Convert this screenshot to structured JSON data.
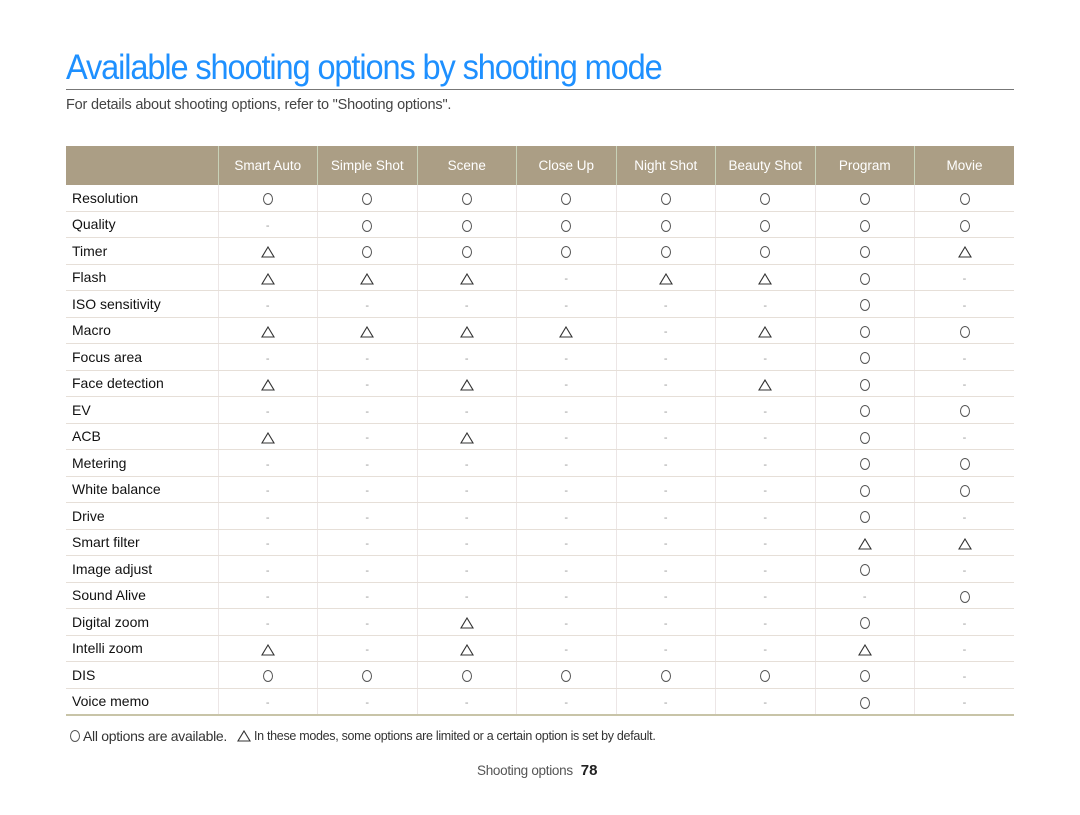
{
  "page": {
    "title": "Available shooting options by shooting mode",
    "subtitle": "For details about shooting options, refer to \"Shooting options\"."
  },
  "colors": {
    "title": "#1e90ff",
    "header_bg": "#ab9e85",
    "header_text": "#ffffff"
  },
  "symbols": {
    "available": "O",
    "limited": "△",
    "unavailable": "-"
  },
  "table": {
    "columns": [
      "Smart Auto",
      "Simple Shot",
      "Scene",
      "Close Up",
      "Night Shot",
      "Beauty Shot",
      "Program",
      "Movie"
    ],
    "rows": [
      {
        "label": "Resolution",
        "values": [
          "O",
          "O",
          "O",
          "O",
          "O",
          "O",
          "O",
          "O"
        ]
      },
      {
        "label": "Quality",
        "values": [
          "-",
          "O",
          "O",
          "O",
          "O",
          "O",
          "O",
          "O"
        ]
      },
      {
        "label": "Timer",
        "values": [
          "△",
          "O",
          "O",
          "O",
          "O",
          "O",
          "O",
          "△"
        ]
      },
      {
        "label": "Flash",
        "values": [
          "△",
          "△",
          "△",
          "-",
          "△",
          "△",
          "O",
          "-"
        ]
      },
      {
        "label": "ISO sensitivity",
        "values": [
          "-",
          "-",
          "-",
          "-",
          "-",
          "-",
          "O",
          "-"
        ]
      },
      {
        "label": "Macro",
        "values": [
          "△",
          "△",
          "△",
          "△",
          "-",
          "△",
          "O",
          "O"
        ]
      },
      {
        "label": "Focus area",
        "values": [
          "-",
          "-",
          "-",
          "-",
          "-",
          "-",
          "O",
          "-"
        ]
      },
      {
        "label": "Face detection",
        "values": [
          "△",
          "-",
          "△",
          "-",
          "-",
          "△",
          "O",
          "-"
        ]
      },
      {
        "label": "EV",
        "values": [
          "-",
          "-",
          "-",
          "-",
          "-",
          "-",
          "O",
          "O"
        ]
      },
      {
        "label": "ACB",
        "values": [
          "△",
          "-",
          "△",
          "-",
          "-",
          "-",
          "O",
          "-"
        ]
      },
      {
        "label": "Metering",
        "values": [
          "-",
          "-",
          "-",
          "-",
          "-",
          "-",
          "O",
          "O"
        ]
      },
      {
        "label": "White balance",
        "values": [
          "-",
          "-",
          "-",
          "-",
          "-",
          "-",
          "O",
          "O"
        ]
      },
      {
        "label": "Drive",
        "values": [
          "-",
          "-",
          "-",
          "-",
          "-",
          "-",
          "O",
          "-"
        ]
      },
      {
        "label": "Smart filter",
        "values": [
          "-",
          "-",
          "-",
          "-",
          "-",
          "-",
          "△",
          "△"
        ]
      },
      {
        "label": "Image adjust",
        "values": [
          "-",
          "-",
          "-",
          "-",
          "-",
          "-",
          "O",
          "-"
        ]
      },
      {
        "label": "Sound Alive",
        "values": [
          "-",
          "-",
          "-",
          "-",
          "-",
          "-",
          "-",
          "O"
        ]
      },
      {
        "label": "Digital zoom",
        "values": [
          "-",
          "-",
          "△",
          "-",
          "-",
          "-",
          "O",
          "-"
        ]
      },
      {
        "label": "Intelli zoom",
        "values": [
          "△",
          "-",
          "△",
          "-",
          "-",
          "-",
          "△",
          "-"
        ]
      },
      {
        "label": "DIS",
        "values": [
          "O",
          "O",
          "O",
          "O",
          "O",
          "O",
          "O",
          "-"
        ]
      },
      {
        "label": "Voice memo",
        "values": [
          "-",
          "-",
          "-",
          "-",
          "-",
          "-",
          "O",
          "-"
        ]
      }
    ]
  },
  "legend": {
    "available_text": "All options are available.",
    "limited_text": "In these modes, some options are limited or a certain option is set by default."
  },
  "footer": {
    "section": "Shooting options",
    "page_number": "78"
  }
}
